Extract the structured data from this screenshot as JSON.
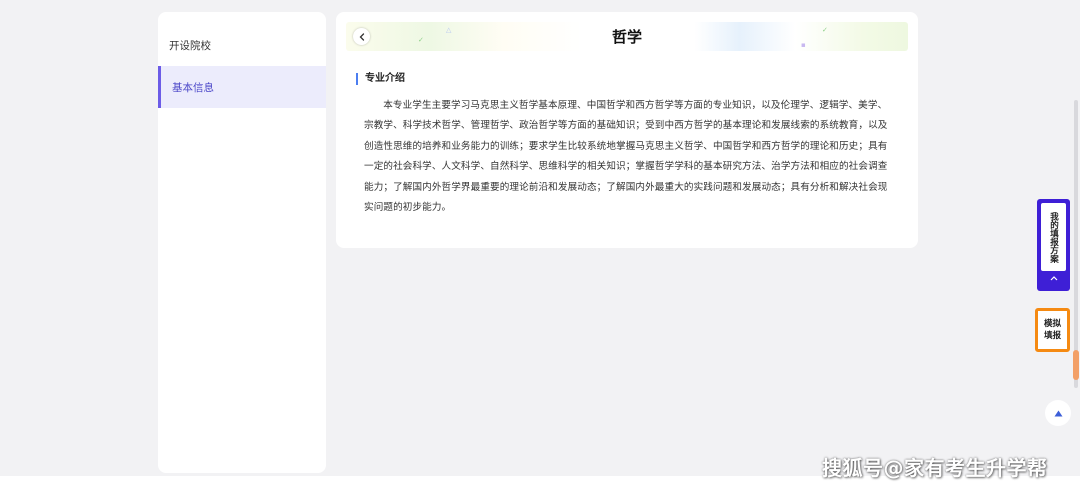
{
  "sidebar": {
    "items": [
      {
        "label": "开设院校",
        "active": false
      },
      {
        "label": "基本信息",
        "active": true
      }
    ]
  },
  "card": {
    "title": "哲学",
    "section_title": "专业介绍",
    "body": "本专业学生主要学习马克思主义哲学基本原理、中国哲学和西方哲学等方面的专业知识，以及伦理学、逻辑学、美学、宗教学、科学技术哲学、管理哲学、政治哲学等方面的基础知识；受到中西方哲学的基本理论和发展线索的系统教育，以及创造性思维的培养和业务能力的训练；要求学生比较系统地掌握马克思主义哲学、中国哲学和西方哲学的理论和历史；具有一定的社会科学、人文科学、自然科学、思维科学的相关知识；掌握哲学学科的基本研究方法、治学方法和相应的社会调查能力；了解国内外哲学界最重要的理论前沿和发展动态；了解国内外最重大的实践问题和发展动态；具有分析和解决社会现实问题的初步能力。"
  },
  "floating": {
    "my_plan_label": "我的填报方案",
    "mock_fill_label": "模拟填报"
  },
  "watermark": "搜狐号@家有考生升学帮",
  "colors": {
    "accent_purple": "#3e1fd6",
    "accent_orange": "#f58a12",
    "active_bg": "#ececfc",
    "active_bar": "#6c5ce7",
    "section_bar": "#4c7ef0"
  },
  "icons": [
    "chevron-left-icon",
    "chevron-up-icon",
    "arrow-up-icon"
  ]
}
